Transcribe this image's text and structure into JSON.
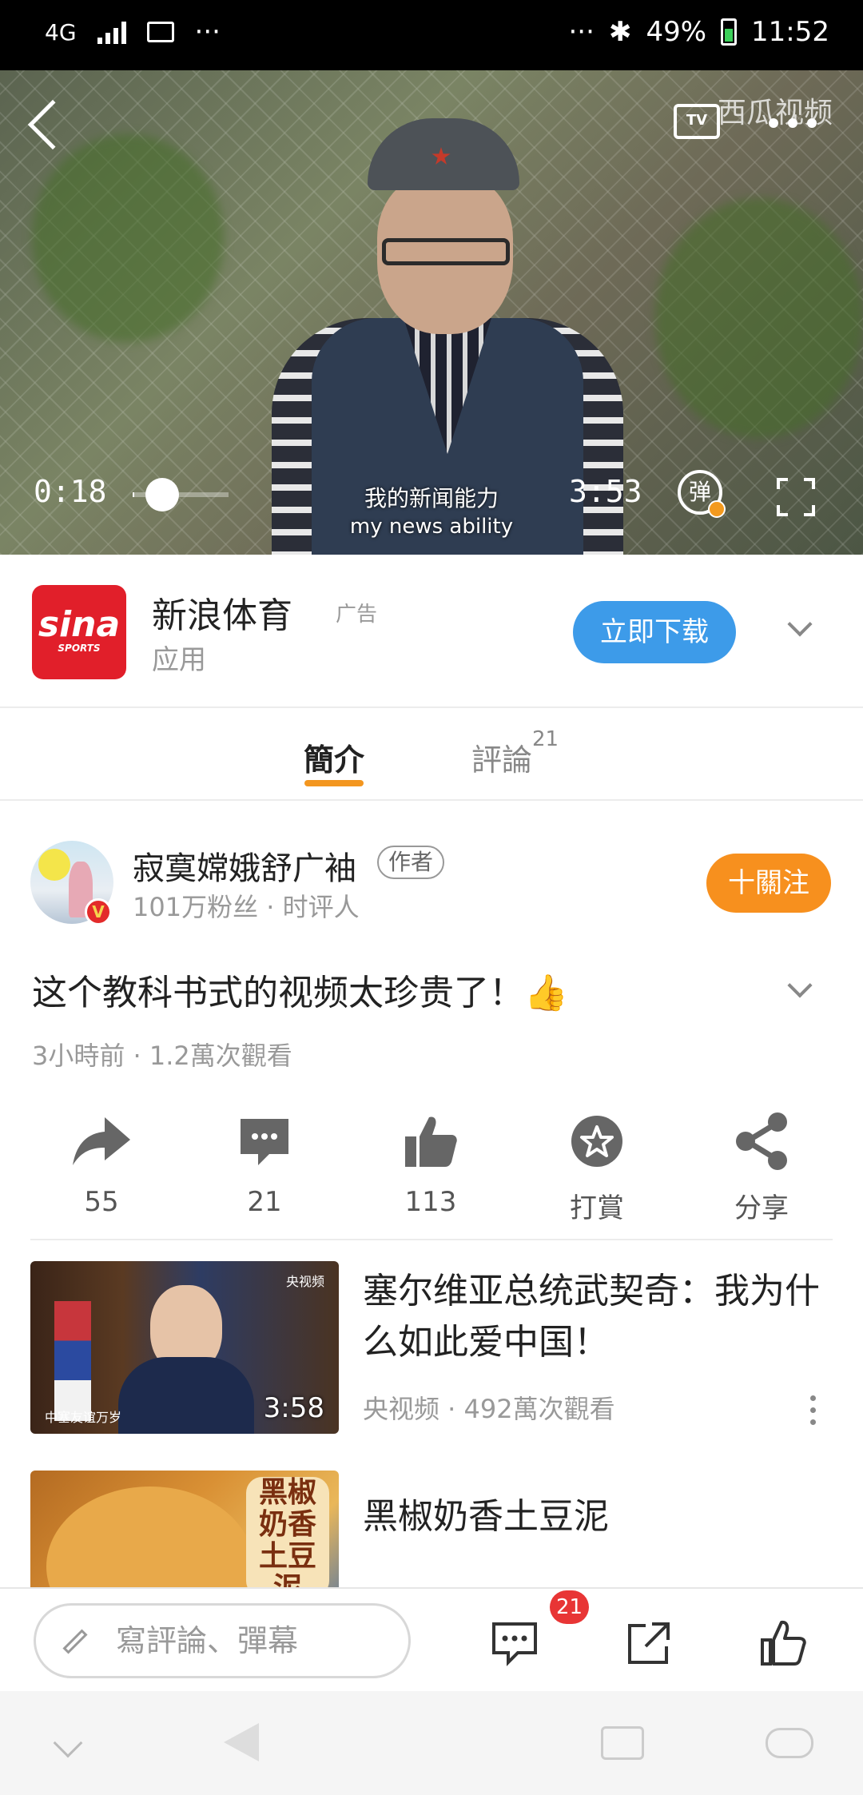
{
  "status_bar": {
    "network": "4G",
    "more": "···",
    "right_more": "···",
    "battery": "49%",
    "time": "11:52"
  },
  "video": {
    "watermark": "西瓜视频",
    "tv_label": "TV",
    "current_time": "0:18",
    "duration": "3:53",
    "progress_fraction": 0.08,
    "subtitle_cn": "我的新闻能力",
    "subtitle_en": "my news ability",
    "danmu_label": "弹"
  },
  "ad": {
    "logo_text": "sina",
    "logo_sub": "SPORTS",
    "title": "新浪体育",
    "tag": "广告",
    "subtitle": "应用",
    "button": "立即下载"
  },
  "tabs": {
    "intro": "簡介",
    "comments": "評論",
    "comment_count": "21"
  },
  "author": {
    "name": "寂寞嫦娥舒广袖",
    "badge": "作者",
    "meta": "101万粉丝 · 时评人",
    "follow": "十關注",
    "verified": "V"
  },
  "video_info": {
    "title": "这个教科书式的视频太珍贵了！👍",
    "meta": "3小時前 · 1.2萬次觀看"
  },
  "actions": [
    {
      "name": "share-forward",
      "icon": "forward-arrow-icon",
      "label": "55"
    },
    {
      "name": "comment",
      "icon": "comment-bubble-icon",
      "label": "21"
    },
    {
      "name": "like",
      "icon": "thumbs-up-icon",
      "label": "113"
    },
    {
      "name": "reward",
      "icon": "star-coin-icon",
      "label": "打賞"
    },
    {
      "name": "share",
      "icon": "share-nodes-icon",
      "label": "分享"
    }
  ],
  "related": [
    {
      "title": "塞尔维亚总统武契奇：我为什么如此爱中国！",
      "meta": "央视频 · 492萬次觀看",
      "duration": "3:58",
      "thumb_caption": "中塞友谊万岁",
      "thumb_logo": "央视频"
    },
    {
      "title": "黑椒奶香土豆泥",
      "meta": "",
      "duration": "",
      "thumb_caption": "黑椒奶香土豆泥"
    }
  ],
  "bottom_bar": {
    "comment_placeholder": "寫評論、彈幕",
    "comment_badge": "21"
  }
}
